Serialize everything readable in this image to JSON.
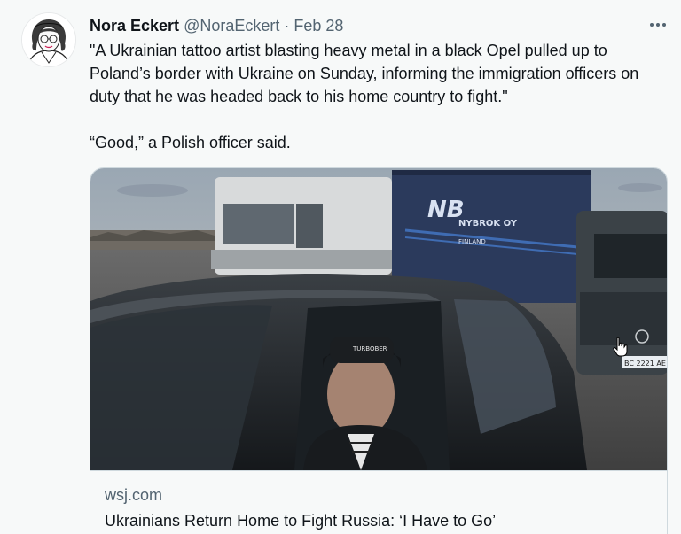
{
  "author": {
    "display_name": "Nora Eckert",
    "handle": "@NoraEckert",
    "separator": "·",
    "date": "Feb 28"
  },
  "tweet": {
    "paragraphs": [
      "\"A Ukrainian tattoo artist blasting heavy metal in a black Opel pulled up to Poland’s border with Ukraine on Sunday, informing the immigration officers on duty that he was headed back to his home country to fight.\"",
      "“Good,” a Polish officer said."
    ]
  },
  "link_card": {
    "domain": "wsj.com",
    "title": "Ukrainians Return Home to Fight Russia: ‘I Have to Go’",
    "image_text": {
      "truck_logo": "NB",
      "truck_company": "NYBROK OY",
      "truck_location": "FINLAND",
      "cap_text": "TURBOBER",
      "van_plate": "BC 2221 AE"
    }
  },
  "icons": {
    "more": "more-horizontal-icon",
    "cursor": "hand-pointer-icon"
  },
  "colors": {
    "background": "#f7f9f9",
    "text_primary": "#0f1419",
    "text_secondary": "#536471",
    "border": "#cfd9de"
  }
}
